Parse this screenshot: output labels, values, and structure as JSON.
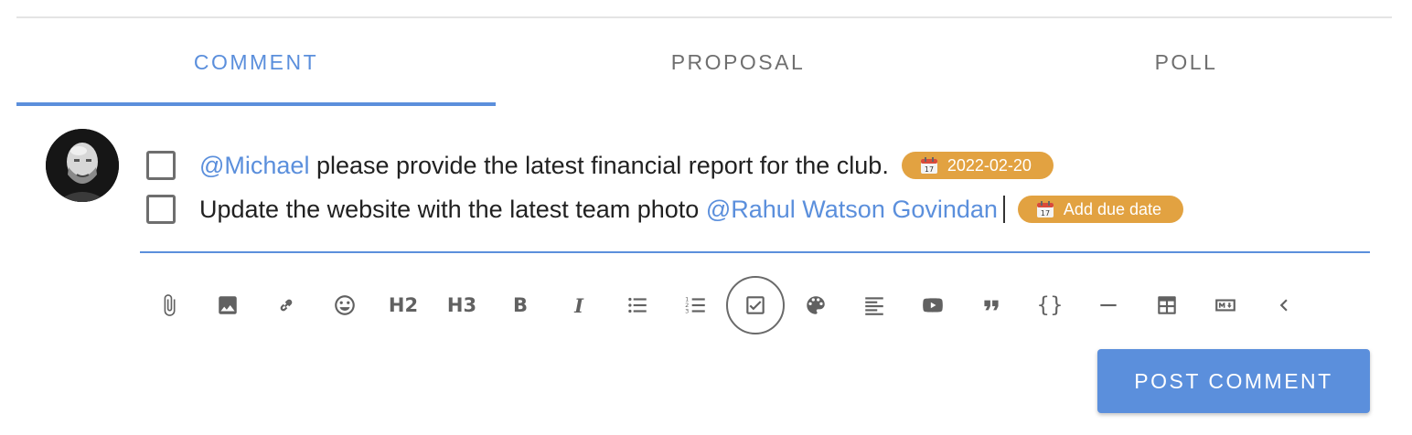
{
  "tabs": [
    {
      "label": "COMMENT",
      "active": true
    },
    {
      "label": "PROPOSAL",
      "active": false
    },
    {
      "label": "POLL",
      "active": false
    }
  ],
  "tasks": [
    {
      "checked": false,
      "mention": "@Michael",
      "text": " please provide the latest financial report for the club.",
      "due_chip": "2022-02-20"
    },
    {
      "checked": false,
      "text": "Update the website with the latest team photo ",
      "mention": "@Rahul Watson Govindan",
      "due_chip": "Add due date"
    }
  ],
  "toolbar": {
    "h2": "H2",
    "h3": "H3",
    "bold": "B",
    "italic": "I",
    "code": "{}",
    "items": [
      "attach-icon",
      "image-icon",
      "link-icon",
      "emoji-icon",
      "heading2",
      "heading3",
      "bold",
      "italic",
      "bullet-list-icon",
      "numbered-list-icon",
      "task-list-icon",
      "color-palette-icon",
      "align-icon",
      "youtube-icon",
      "quote-icon",
      "code-block",
      "horizontal-rule-icon",
      "table-icon",
      "markdown-icon",
      "collapse-icon"
    ],
    "active_item": "task-list-icon"
  },
  "post_button": "POST COMMENT",
  "colors": {
    "accent": "#5b8fdc",
    "chip": "#e2a241",
    "icon": "#616161"
  }
}
